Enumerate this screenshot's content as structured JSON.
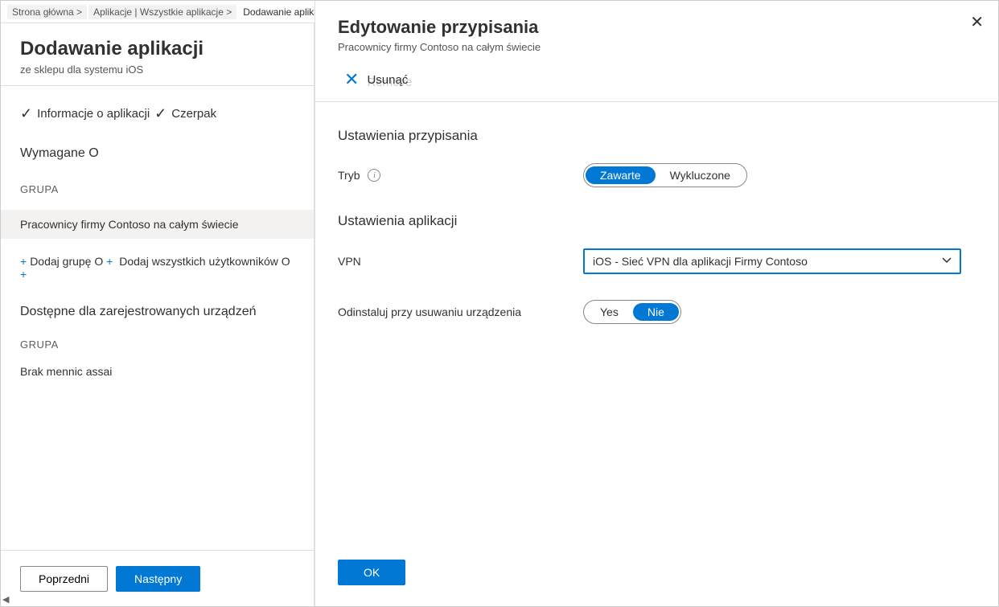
{
  "breadcrumb": {
    "home": "Strona główna >",
    "apps": "Aplikacje | Wszystkie aplikacje >",
    "current": "Dodawanie aplikacji"
  },
  "left": {
    "title": "Dodawanie aplikacji",
    "subtitle": "ze sklepu dla systemu iOS",
    "step1": "Informacje o aplikacji",
    "step2": "Czerpak",
    "required_label": "Wymagane O",
    "group_header": "GRUPA",
    "group_row": "Pracownicy firmy Contoso na całym świecie",
    "add_group": "Dodaj grupę O",
    "add_users": "Dodaj wszystkich użytkowników O",
    "plus_tail": "+",
    "available_label": "Dostępne dla zarejestrowanych urządzeń",
    "group_header2": "GRUPA",
    "no_items": "Brak mennic assai",
    "prev": "Poprzedni",
    "next": "Następny"
  },
  "right": {
    "title": "Edytowanie przypisania",
    "subtitle": "Pracownicy firmy Contoso na całym świecie",
    "remove": "Usunąć",
    "remove_ghost": "Remove",
    "assign_settings": "Ustawienia przypisania",
    "mode_label": "Tryb",
    "mode_included": "Zawarte",
    "mode_excluded": "Wykluczone",
    "app_settings": "Ustawienia aplikacji",
    "vpn_label": "VPN",
    "vpn_value": "iOS - Sieć VPN dla aplikacji Firmy Contoso",
    "uninstall_label": "Odinstaluj przy usuwaniu urządzenia",
    "yes": "Yes",
    "no": "Nie",
    "ok": "OK"
  }
}
